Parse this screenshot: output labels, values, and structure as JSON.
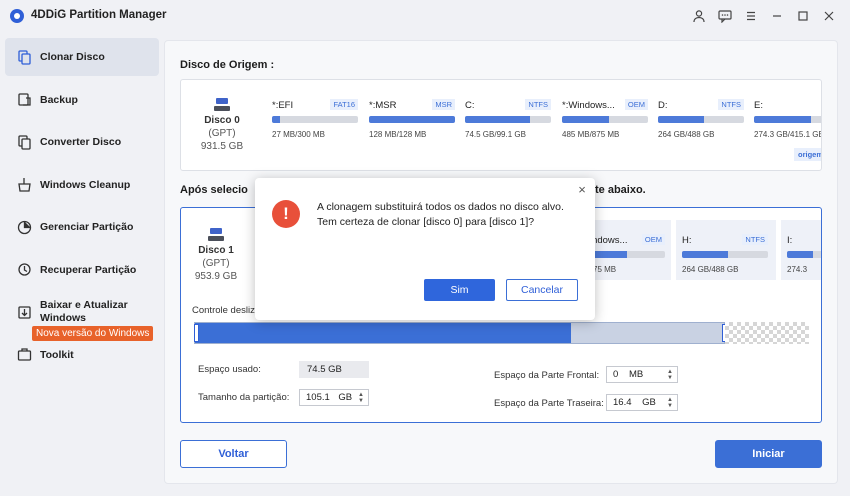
{
  "app": {
    "title": "4DDiG Partition Manager",
    "icons": [
      "user-icon",
      "feedback-icon",
      "menu-icon",
      "minimize-icon",
      "maximize-icon",
      "close-icon"
    ]
  },
  "sidebar": {
    "items": [
      {
        "label": "Clonar Disco",
        "icon": "clone-disk-icon",
        "active": true
      },
      {
        "label": "Backup",
        "icon": "backup-icon"
      },
      {
        "label": "Converter Disco",
        "icon": "convert-disk-icon"
      },
      {
        "label": "Windows Cleanup",
        "icon": "cleanup-icon"
      },
      {
        "label": "Gerenciar Partição",
        "icon": "partition-icon"
      },
      {
        "label": "Recuperar Partição",
        "icon": "recover-partition-icon"
      },
      {
        "label": "Baixar e Atualizar Windows",
        "icon": "download-windows-icon"
      },
      {
        "label": "Toolkit",
        "icon": "toolkit-icon"
      }
    ],
    "new_badge": "Nova versão do Windows"
  },
  "source": {
    "title": "Disco de Origem :",
    "disk": {
      "name": "Disco 0",
      "type": "(GPT)",
      "size": "931.5 GB"
    },
    "partitions": [
      {
        "name": "*:EFI",
        "fs": "FAT16",
        "size": "27 MB/300 MB",
        "used": 0.09
      },
      {
        "name": "*:MSR",
        "fs": "MSR",
        "size": "128 MB/128 MB",
        "used": 1.0
      },
      {
        "name": "C:",
        "fs": "NTFS",
        "size": "74.5 GB/99.1 GB",
        "used": 0.75
      },
      {
        "name": "*:Windows...",
        "fs": "OEM",
        "size": "485 MB/875 MB",
        "used": 0.55
      },
      {
        "name": "D:",
        "fs": "NTFS",
        "size": "264 GB/488 GB",
        "used": 0.54
      },
      {
        "name": "E:",
        "fs": "N",
        "size": "274.3 GB/415.1 GB",
        "used": 0.66
      }
    ],
    "origin_tag": "origem"
  },
  "target": {
    "title_left": "Após selecio",
    "title_right": "te abaixo.",
    "disk": {
      "name": "Disco 1",
      "type": "(GPT)",
      "size": "953.9 GB"
    },
    "partitions": [
      {
        "name": "Windows...",
        "fs": "OEM",
        "size": "B/875 MB",
        "used": 0.55
      },
      {
        "name": "H:",
        "fs": "NTFS",
        "size": "264 GB/488 GB",
        "used": 0.54
      },
      {
        "name": "I:",
        "fs": "",
        "size": "274.3",
        "used": 0.66
      }
    ],
    "slider_label": "Controle desliz",
    "slider_used": 0.71
  },
  "fields": {
    "used_label": "Espaço usado:",
    "used_value": "74.5 GB",
    "partition_size_label": "Tamanho da partição:",
    "partition_size_value": "105.1",
    "partition_size_unit": "GB",
    "front_label": "Espaço da Parte Frontal:",
    "front_value": "0",
    "front_unit": "MB",
    "back_label": "Espaço da Parte Traseira:",
    "back_value": "16.4",
    "back_unit": "GB"
  },
  "buttons": {
    "back": "Voltar",
    "start": "Iniciar"
  },
  "dialog": {
    "icon_glyph": "!",
    "line1": "A clonagem substituirá todos os dados no disco alvo.",
    "line2": "Tem certeza de clonar [disco 0] para [disco 1]?",
    "yes": "Sim",
    "cancel": "Cancelar",
    "close_glyph": "×"
  },
  "colors": {
    "accent": "#3b6fd6",
    "badge": "#e8622a",
    "warning": "#e8503a"
  }
}
